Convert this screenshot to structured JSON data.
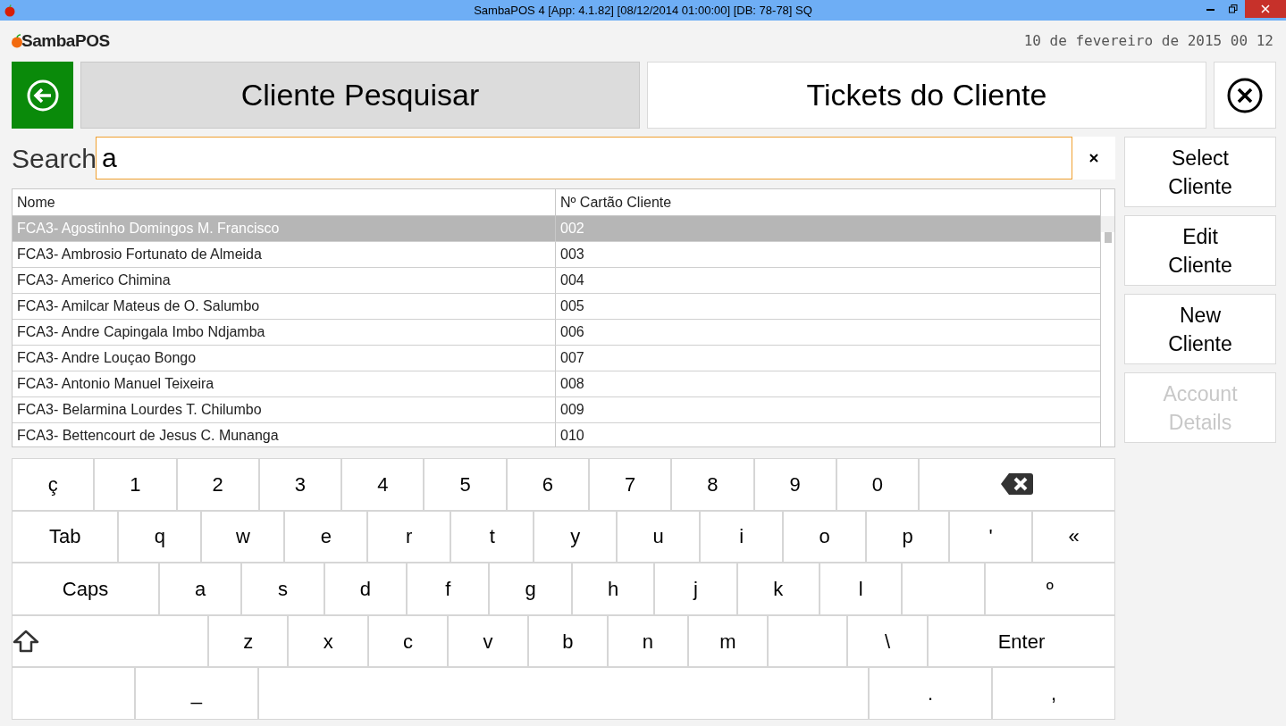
{
  "window": {
    "title": "SambaPOS 4 [App: 4.1.82] [08/12/2014 01:00:00] [DB: 78-78] SQ"
  },
  "header": {
    "logo": "SambaPOS",
    "datetime": "10 de fevereiro de 2015 00 12"
  },
  "nav": [
    {
      "label": "Cliente Pesquisar",
      "selected": true
    },
    {
      "label": "Tickets do Cliente",
      "selected": false
    }
  ],
  "search": {
    "label": "Search",
    "value": "a"
  },
  "table": {
    "columns": [
      "Nome",
      "Nº Cartão Cliente"
    ],
    "rows": [
      {
        "cells": [
          "FCA3- Agostinho Domingos M. Francisco",
          "002"
        ],
        "selected": true
      },
      {
        "cells": [
          "FCA3- Ambrosio Fortunato de Almeida",
          "003"
        ],
        "selected": false
      },
      {
        "cells": [
          "FCA3- Americo Chimina",
          "004"
        ],
        "selected": false
      },
      {
        "cells": [
          "FCA3- Amilcar Mateus de O. Salumbo",
          "005"
        ],
        "selected": false
      },
      {
        "cells": [
          "FCA3- Andre Capingala Imbo Ndjamba",
          "006"
        ],
        "selected": false
      },
      {
        "cells": [
          "FCA3- Andre Louçao Bongo",
          "007"
        ],
        "selected": false
      },
      {
        "cells": [
          "FCA3- Antonio Manuel Teixeira",
          "008"
        ],
        "selected": false
      },
      {
        "cells": [
          "FCA3- Belarmina Lourdes T. Chilumbo",
          "009"
        ],
        "selected": false
      },
      {
        "cells": [
          "FCA3- Bettencourt de Jesus C. Munanga",
          "010"
        ],
        "selected": false
      }
    ]
  },
  "actions": [
    {
      "lines": [
        "Select",
        "Cliente"
      ],
      "disabled": false
    },
    {
      "lines": [
        "Edit",
        "Cliente"
      ],
      "disabled": false
    },
    {
      "lines": [
        "New",
        "Cliente"
      ],
      "disabled": false
    },
    {
      "lines": [
        "Account",
        "Details"
      ],
      "disabled": true
    }
  ],
  "keyboard": [
    [
      {
        "kind": "char",
        "label": "ç"
      },
      {
        "kind": "char",
        "label": "1"
      },
      {
        "kind": "char",
        "label": "2"
      },
      {
        "kind": "char",
        "label": "3"
      },
      {
        "kind": "char",
        "label": "4"
      },
      {
        "kind": "char",
        "label": "5"
      },
      {
        "kind": "char",
        "label": "6"
      },
      {
        "kind": "char",
        "label": "7"
      },
      {
        "kind": "char",
        "label": "8"
      },
      {
        "kind": "char",
        "label": "9"
      },
      {
        "kind": "char",
        "label": "0"
      },
      {
        "kind": "backspace"
      }
    ],
    [
      {
        "kind": "char",
        "label": "Tab"
      },
      {
        "kind": "char",
        "label": "q"
      },
      {
        "kind": "char",
        "label": "w"
      },
      {
        "kind": "char",
        "label": "e"
      },
      {
        "kind": "char",
        "label": "r"
      },
      {
        "kind": "char",
        "label": "t"
      },
      {
        "kind": "char",
        "label": "y"
      },
      {
        "kind": "char",
        "label": "u"
      },
      {
        "kind": "char",
        "label": "i"
      },
      {
        "kind": "char",
        "label": "o"
      },
      {
        "kind": "char",
        "label": "p"
      },
      {
        "kind": "char",
        "label": "'"
      },
      {
        "kind": "char",
        "label": "«"
      }
    ],
    [
      {
        "kind": "char",
        "label": "Caps"
      },
      {
        "kind": "char",
        "label": "a"
      },
      {
        "kind": "char",
        "label": "s"
      },
      {
        "kind": "char",
        "label": "d"
      },
      {
        "kind": "char",
        "label": "f"
      },
      {
        "kind": "char",
        "label": "g"
      },
      {
        "kind": "char",
        "label": "h"
      },
      {
        "kind": "char",
        "label": "j"
      },
      {
        "kind": "char",
        "label": "k"
      },
      {
        "kind": "char",
        "label": "l"
      },
      {
        "kind": "blank"
      },
      {
        "kind": "char",
        "label": "º"
      }
    ],
    [
      {
        "kind": "shift"
      },
      {
        "kind": "char",
        "label": "z"
      },
      {
        "kind": "char",
        "label": "x"
      },
      {
        "kind": "char",
        "label": "c"
      },
      {
        "kind": "char",
        "label": "v"
      },
      {
        "kind": "char",
        "label": "b"
      },
      {
        "kind": "char",
        "label": "n"
      },
      {
        "kind": "char",
        "label": "m"
      },
      {
        "kind": "blank"
      },
      {
        "kind": "char",
        "label": "\\"
      },
      {
        "kind": "char",
        "label": "Enter"
      }
    ],
    [
      {
        "kind": "blank"
      },
      {
        "kind": "char",
        "label": "_"
      },
      {
        "kind": "blank"
      },
      {
        "kind": "char",
        "label": "."
      },
      {
        "kind": "char",
        "label": ","
      }
    ]
  ]
}
